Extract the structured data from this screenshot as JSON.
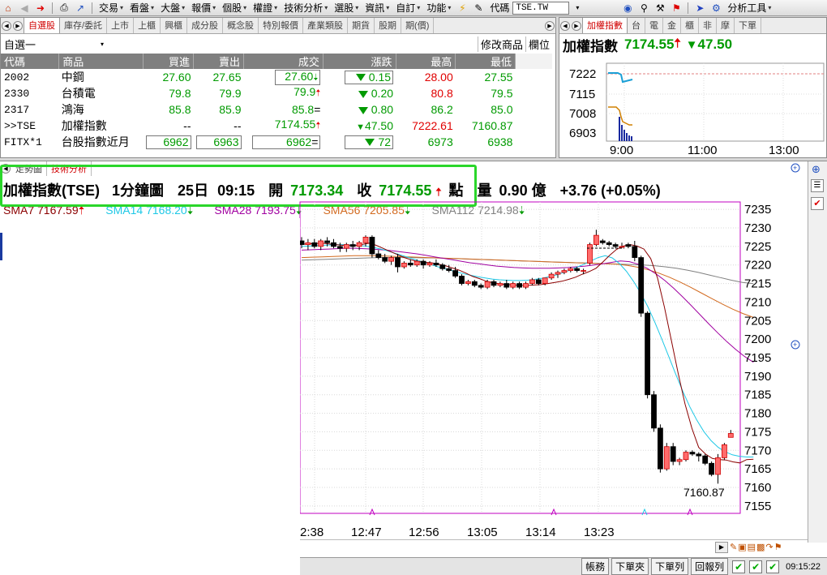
{
  "menubar": {
    "items": [
      "交易",
      "看盤",
      "大盤",
      "報價",
      "個股",
      "權證",
      "技術分析",
      "選股",
      "資訊",
      "自訂",
      "功能"
    ],
    "code_label": "代碼",
    "code_value": "TSE.TW",
    "analysis_tools": "分析工具"
  },
  "watchlist": {
    "tabs": [
      "自選股",
      "庫存/委託",
      "上市",
      "上櫃",
      "興櫃",
      "成分股",
      "概念股",
      "特別報價",
      "產業類股",
      "期貨",
      "股期",
      "期(價)"
    ],
    "group": "自選一",
    "modify_button": "修改商品",
    "columns_button": "欄位",
    "headers": [
      "代碼",
      "商品",
      "買進",
      "賣出",
      "成交",
      "漲跌",
      "最高",
      "最低"
    ],
    "rows": [
      {
        "code": "2002",
        "name": "中鋼",
        "bid": "27.60",
        "ask": "27.65",
        "last": "27.60",
        "last_dir": "down",
        "chg": "0.15",
        "high": "28.00",
        "low": "27.55"
      },
      {
        "code": "2330",
        "name": "台積電",
        "bid": "79.8",
        "ask": "79.9",
        "last": "79.9",
        "last_dir": "up",
        "chg": "0.20",
        "high": "80.8",
        "low": "79.5"
      },
      {
        "code": "2317",
        "name": "鴻海",
        "bid": "85.8",
        "ask": "85.9",
        "last": "85.8",
        "last_dir": "flat",
        "chg": "0.80",
        "high": "86.2",
        "low": "85.0"
      },
      {
        "code": ">>TSE",
        "name": "加權指數",
        "bid": "--",
        "ask": "--",
        "last": "7174.55",
        "last_dir": "up",
        "chg": "47.50",
        "high": "7222.61",
        "low": "7160.87"
      },
      {
        "code": "FITX*1",
        "name": "台股指數近月",
        "bid": "6962",
        "ask": "6963",
        "last": "6962",
        "last_dir": "flat",
        "chg": "72",
        "high": "6973",
        "low": "6938"
      }
    ]
  },
  "index_panel": {
    "tabs": [
      "加權指數",
      "台",
      "電",
      "金",
      "櫃",
      "非",
      "摩",
      "下單"
    ],
    "title": "加權指數",
    "value": "7174.55",
    "change": "47.50",
    "y_labels": [
      "7222",
      "7115",
      "7008",
      "6903"
    ],
    "x_labels": [
      "9:00",
      "11:00",
      "13:00"
    ]
  },
  "chart": {
    "tabs": [
      "走勢圖",
      "技術分析"
    ],
    "name": "加權指數(TSE)",
    "period": "1分鐘圖",
    "date": "25日",
    "time": "09:15",
    "open_label": "開",
    "open": "7173.34",
    "close_label": "收",
    "close": "7174.55",
    "unit": "點",
    "vol_label": "量",
    "vol": "0.90 億",
    "change": "+3.76 (+0.05%)",
    "sma": [
      {
        "label": "SMA7 7167.59",
        "color": "#8b0000",
        "dir": "up"
      },
      {
        "label": "SMA14 7168.20",
        "color": "#1ec8e6",
        "dir": "down"
      },
      {
        "label": "SMA28 7193.75",
        "color": "#a000a0",
        "dir": "down"
      },
      {
        "label": "SMA56 7205.85",
        "color": "#d2691e",
        "dir": "down"
      },
      {
        "label": "SMA112 7214.98",
        "color": "#808080",
        "dir": "down"
      }
    ],
    "y_ticks": [
      "7235",
      "7230",
      "7225",
      "7220",
      "7215",
      "7210",
      "7205",
      "7200",
      "7195",
      "7190",
      "7185",
      "7180",
      "7175",
      "7170",
      "7165",
      "7160",
      "7155"
    ],
    "x_ticks": [
      "2:38",
      "12:47",
      "12:56",
      "13:05",
      "13:14",
      "13:23"
    ],
    "low_annotation": "7160.87"
  },
  "chart_data": {
    "type": "candlestick",
    "y_range": [
      7153,
      7237
    ],
    "y_ticks": [
      7235,
      7230,
      7225,
      7220,
      7215,
      7210,
      7205,
      7200,
      7195,
      7190,
      7185,
      7180,
      7175,
      7170,
      7165,
      7160,
      7155
    ],
    "x_ticks": [
      "2:38",
      "12:47",
      "12:56",
      "13:05",
      "13:14",
      "13:23"
    ],
    "candles": [
      [
        7226.5,
        7227.5,
        7224.5,
        7225.5
      ],
      [
        7225.5,
        7227,
        7224,
        7226
      ],
      [
        7226,
        7227,
        7224.5,
        7225
      ],
      [
        7225,
        7227,
        7224,
        7226.5
      ],
      [
        7226.5,
        7227.5,
        7225,
        7226
      ],
      [
        7226,
        7227,
        7224.5,
        7225
      ],
      [
        7225,
        7226,
        7223.5,
        7224.5
      ],
      [
        7224.5,
        7226,
        7223.5,
        7225.5
      ],
      [
        7225.5,
        7226.5,
        7224,
        7225
      ],
      [
        7225,
        7226.5,
        7224,
        7226
      ],
      [
        7226,
        7228,
        7225,
        7227.5
      ],
      [
        7227.5,
        7228,
        7222,
        7223
      ],
      [
        7223,
        7224,
        7221.5,
        7222
      ],
      [
        7222,
        7223,
        7220.5,
        7221
      ],
      [
        7221,
        7222.5,
        7220,
        7222
      ],
      [
        7222,
        7223,
        7218,
        7219.5
      ],
      [
        7219.5,
        7221,
        7219,
        7220.5
      ],
      [
        7220.5,
        7221.5,
        7219.5,
        7220
      ],
      [
        7220,
        7221.5,
        7219.5,
        7221
      ],
      [
        7221,
        7221.5,
        7219,
        7220
      ],
      [
        7220,
        7221,
        7219.5,
        7220.5
      ],
      [
        7220.5,
        7221.5,
        7219.5,
        7220
      ],
      [
        7220,
        7220.5,
        7218.5,
        7219
      ],
      [
        7219,
        7220,
        7218,
        7218.5
      ],
      [
        7218.5,
        7219.5,
        7216.5,
        7217
      ],
      [
        7217,
        7217.5,
        7214.5,
        7215
      ],
      [
        7215,
        7216,
        7214.5,
        7215.5
      ],
      [
        7215.5,
        7216,
        7214,
        7214.5
      ],
      [
        7214.5,
        7215,
        7213.5,
        7214
      ],
      [
        7214,
        7216,
        7213.5,
        7215.5
      ],
      [
        7215.5,
        7216,
        7214,
        7214.5
      ],
      [
        7214.5,
        7215.5,
        7214,
        7215
      ],
      [
        7215,
        7216,
        7213.5,
        7214
      ],
      [
        7214,
        7215.5,
        7213.5,
        7215
      ],
      [
        7215,
        7215.5,
        7213.5,
        7214
      ],
      [
        7214,
        7215.5,
        7213.5,
        7215
      ],
      [
        7215,
        7216.5,
        7214.5,
        7216
      ],
      [
        7216,
        7216.5,
        7214.5,
        7215
      ],
      [
        7215,
        7216.5,
        7214.5,
        7216.5
      ],
      [
        7216.5,
        7218,
        7216,
        7217.5
      ],
      [
        7217.5,
        7218.5,
        7216.5,
        7218
      ],
      [
        7218,
        7219,
        7217.5,
        7218.5
      ],
      [
        7218.5,
        7219.5,
        7218,
        7219
      ],
      [
        7219,
        7219.5,
        7218,
        7218.5
      ],
      [
        7218.5,
        7219,
        7217.5,
        7218.5
      ],
      [
        7220.5,
        7226,
        7220,
        7225.5
      ],
      [
        7225.5,
        7229.5,
        7225,
        7228
      ],
      [
        7226.5,
        7227,
        7225.5,
        7226
      ],
      [
        7226,
        7226.5,
        7225,
        7225.5
      ],
      [
        7225.5,
        7226,
        7224.5,
        7225
      ],
      [
        7225,
        7226,
        7224.5,
        7225
      ],
      [
        7225.5,
        7226,
        7224.5,
        7225
      ],
      [
        7225,
        7226.5,
        7221,
        7222
      ],
      [
        7222,
        7222.5,
        7206,
        7207
      ],
      [
        7207,
        7207.5,
        7184,
        7185
      ],
      [
        7185,
        7186,
        7175,
        7176
      ],
      [
        7176,
        7177,
        7164,
        7165
      ],
      [
        7165,
        7172,
        7164.5,
        7171
      ],
      [
        7171,
        7172,
        7166,
        7167
      ],
      [
        7167,
        7168,
        7166,
        7167.5
      ],
      [
        7167.5,
        7170,
        7167,
        7169.5
      ],
      [
        7169.5,
        7170,
        7168.5,
        7169
      ],
      [
        7169,
        7169.5,
        7167,
        7168.5
      ],
      [
        7168.5,
        7169,
        7166,
        7166.5
      ],
      [
        7166.5,
        7167,
        7163,
        7163.5
      ],
      [
        7163.5,
        7169,
        7161,
        7168
      ],
      [
        7168,
        7172,
        7167.5,
        7171.5
      ],
      [
        7173.5,
        7175.5,
        7173.5,
        7174.55
      ]
    ],
    "sma7": [
      7225.6,
      7225.7,
      7225.8,
      7225.9,
      7225.7,
      7225.5,
      7225.3,
      7225.2,
      7225.3,
      7225.6,
      7225.9,
      7225.2,
      7224.4,
      7223.6,
      7222.8,
      7222.0,
      7221.4,
      7220.9,
      7220.7,
      7220.6,
      7220.2,
      7219.8,
      7219.2,
      7218.6,
      7217.8,
      7216.9,
      7216.3,
      7215.6,
      7215.2,
      7214.9,
      7214.7,
      7214.6,
      7214.5,
      7214.5,
      7214.6,
      7214.7,
      7215.0,
      7215.3,
      7215.6,
      7216.1,
      7216.7,
      7217.5,
      7218.2,
      7219.1,
      7220.8,
      7222.6,
      7224.2,
      7225.1,
      7225.5,
      7225.1,
      7224.3,
      7221.7,
      7216.4,
      7208.6,
      7199.7,
      7190.8,
      7182.5,
      7176.0,
      7170.8,
      7169.0,
      7167.8,
      7167.5,
      7167.4,
      7166.9,
      7166.6,
      7167.5,
      7167.59
    ],
    "sma14": [
      7225.0,
      7225.1,
      7225.2,
      7225.3,
      7225.4,
      7225.5,
      7225.5,
      7225.4,
      7225.3,
      7225.1,
      7224.8,
      7224.4,
      7223.9,
      7223.3,
      7222.7,
      7222.1,
      7221.5,
      7220.9,
      7220.3,
      7219.7,
      7219.1,
      7218.6,
      7218.1,
      7217.6,
      7217.2,
      7216.8,
      7216.5,
      7216.2,
      7216.0,
      7215.9,
      7215.8,
      7215.8,
      7215.9,
      7216.1,
      7216.4,
      7216.8,
      7217.3,
      7217.9,
      7218.6,
      7219.4,
      7220.2,
      7221.1,
      7222.0,
      7222.5,
      7221.9,
      7220.4,
      7218.3,
      7215.6,
      7212.5,
      7208.9,
      7204.7,
      7200.1,
      7195.3,
      7190.5,
      7185.9,
      7181.7,
      7178.1,
      7175.0,
      7172.6,
      7170.8,
      7169.6,
      7168.8,
      7168.4,
      7168.2,
      7168.2
    ],
    "sma28": [
      7224.0,
      7224.1,
      7224.2,
      7224.3,
      7224.4,
      7224.5,
      7224.5,
      7224.4,
      7224.3,
      7224.1,
      7223.9,
      7223.6,
      7223.3,
      7223.0,
      7222.6,
      7222.2,
      7221.8,
      7221.4,
      7221.0,
      7220.6,
      7220.3,
      7220.0,
      7219.7,
      7219.5,
      7219.3,
      7219.2,
      7219.1,
      7219.1,
      7219.1,
      7219.2,
      7219.3,
      7219.5,
      7219.7,
      7220.0,
      7220.3,
      7220.7,
      7221.1,
      7220.9,
      7220.2,
      7219.1,
      7217.6,
      7215.8,
      7213.7,
      7211.4,
      7209.0,
      7206.5,
      7204.0,
      7201.6,
      7199.3,
      7197.2,
      7195.3,
      7193.75
    ],
    "sma56": [
      7222.0,
      7222.1,
      7222.2,
      7222.3,
      7222.4,
      7222.5,
      7222.5,
      7222.5,
      7222.4,
      7222.3,
      7222.2,
      7222.1,
      7222.0,
      7221.9,
      7221.8,
      7221.7,
      7221.6,
      7221.5,
      7221.4,
      7221.3,
      7221.2,
      7221.1,
      7221.0,
      7220.9,
      7220.8,
      7220.7,
      7220.6,
      7220.5,
      7220.4,
      7220.3,
      7220.2,
      7219.9,
      7219.4,
      7218.7,
      7217.8,
      7216.7,
      7215.4,
      7214.0,
      7212.5,
      7211.0,
      7209.5,
      7208.1,
      7206.9,
      7205.85
    ],
    "sma112": [
      7221.3,
      7221.4,
      7221.5,
      7221.6,
      7221.7,
      7221.8,
      7221.9,
      7222.0,
      7222.0,
      7222.0,
      7222.0,
      7221.9,
      7221.9,
      7221.8,
      7221.7,
      7221.6,
      7221.5,
      7221.4,
      7221.3,
      7221.2,
      7221.1,
      7221.0,
      7220.9,
      7220.8,
      7220.7,
      7220.6,
      7220.5,
      7220.4,
      7220.3,
      7220.2,
      7220.1,
      7220.0,
      7219.8,
      7219.5,
      7219.1,
      7218.6,
      7218.0,
      7217.3,
      7216.6,
      7215.9,
      7215.3,
      7214.98
    ]
  },
  "toolbar_bottom": {
    "buttons": [
      "帳務",
      "下單夾",
      "下單列",
      "回報列"
    ],
    "time": "09:15:22"
  }
}
